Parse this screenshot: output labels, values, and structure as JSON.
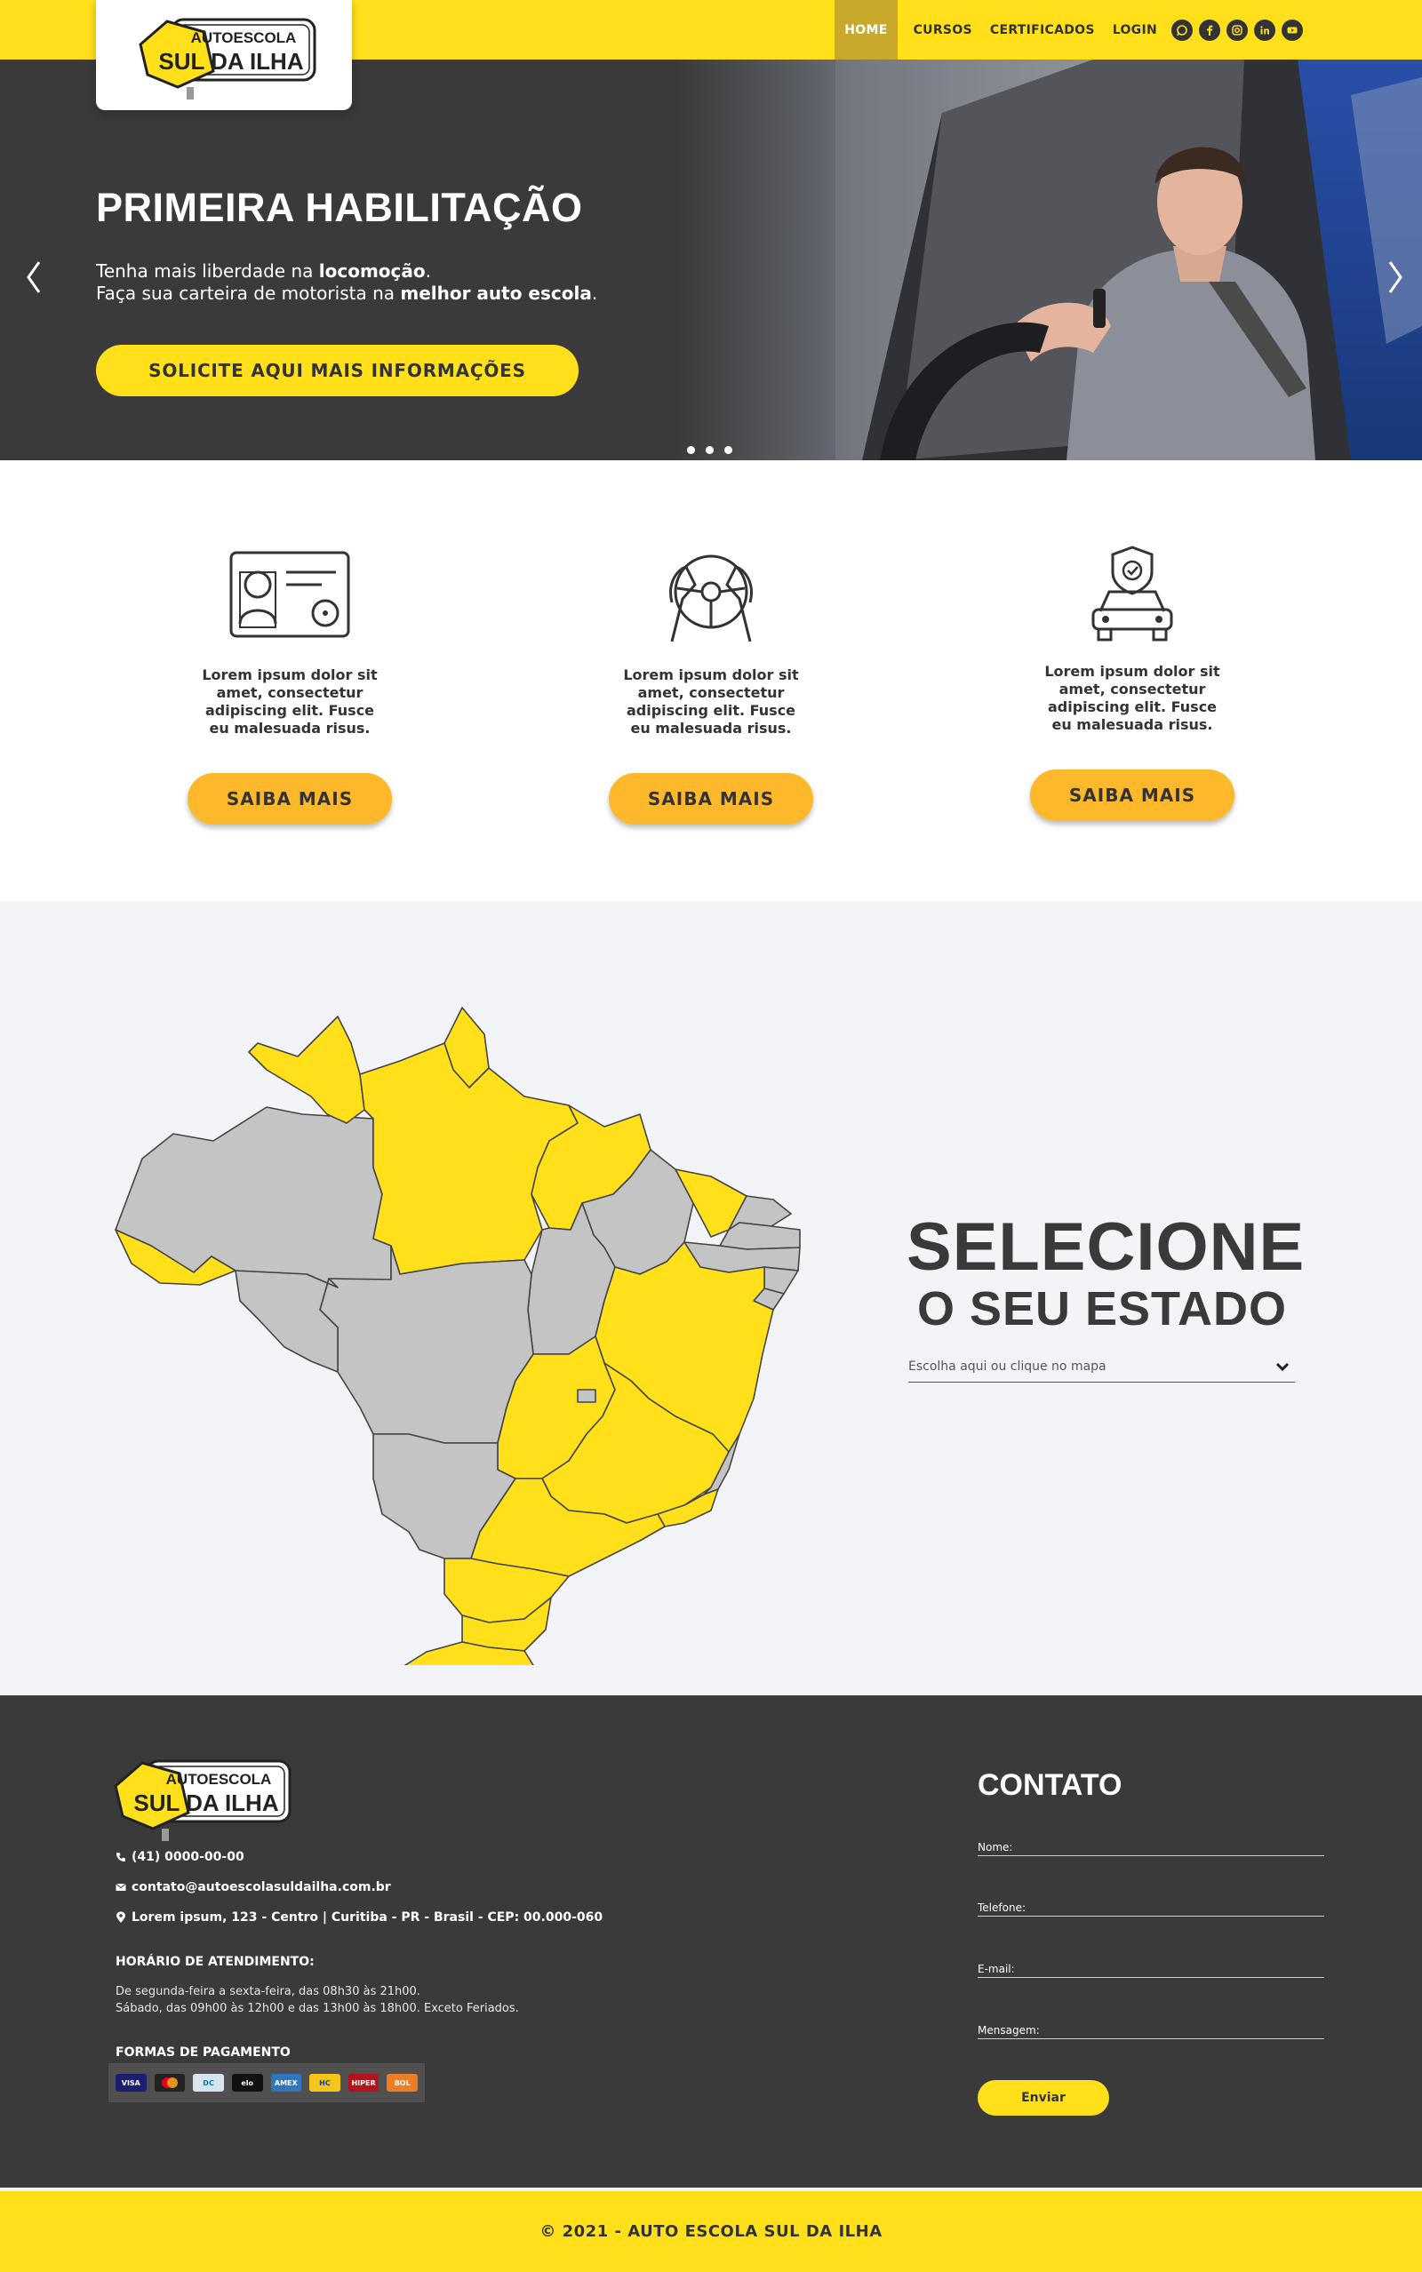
{
  "brand": {
    "logo_top": "AUTOESCOLA",
    "logo_main": "SUL DA ILHA"
  },
  "nav": {
    "items": [
      {
        "label": "HOME"
      },
      {
        "label": "CURSOS"
      },
      {
        "label": "CERTIFICADOS"
      },
      {
        "label": "LOGIN"
      }
    ],
    "socials": [
      "whatsapp-icon",
      "facebook-icon",
      "instagram-icon",
      "linkedin-icon",
      "youtube-icon"
    ]
  },
  "hero": {
    "title": "PRIMEIRA HABILITAÇÃO",
    "line1_pre": "Tenha mais liberdade na ",
    "line1_bold": "locomoção",
    "line1_post": ".",
    "line2_pre": "Faça sua carteira de motorista na ",
    "line2_bold": "melhor auto escola",
    "line2_post": ".",
    "cta": "SOLICITE AQUI MAIS INFORMAÇÕES",
    "slides_count": 3
  },
  "features": [
    {
      "icon": "driver-license-icon",
      "text": "Lorem ipsum dolor sit amet, consectetur adipiscing elit. Fusce eu malesuada risus.",
      "button": "SAIBA MAIS"
    },
    {
      "icon": "steering-wheel-icon",
      "text": "Lorem ipsum dolor sit amet, consectetur adipiscing elit. Fusce eu malesuada risus.",
      "button": "SAIBA MAIS"
    },
    {
      "icon": "car-shield-icon",
      "text": "Lorem ipsum dolor sit amet, consectetur adipiscing elit. Fusce eu malesuada risus.",
      "button": "SAIBA MAIS"
    }
  ],
  "map": {
    "title_line1": "SELECIONE",
    "title_line2": "O SEU ESTADO",
    "select_placeholder": "Escolha aqui ou clique no mapa",
    "highlight_color": "#ffe01b",
    "inactive_color": "#c4c4c4"
  },
  "footer": {
    "phone": "(41) 0000-00-00",
    "email": "contato@autoescolasuldailha.com.br",
    "address": "Lorem ipsum, 123 - Centro | Curitiba - PR - Brasil - CEP: 00.000-060",
    "hours_title": "HORÁRIO DE ATENDIMENTO:",
    "hours_line1": "De segunda-feira a sexta-feira, das 08h30 às 21h00.",
    "hours_line2": "Sábado, das 09h00 às 12h00 e das 13h00 às 18h00. Exceto Feriados.",
    "payment_title": "FORMAS DE PAGAMENTO",
    "payment_methods": [
      "VISA",
      "MC",
      "DC",
      "elo",
      "AMEX",
      "HC",
      "HIPER",
      "BOL"
    ],
    "contact_title": "CONTATO",
    "fields": {
      "name": "Nome:",
      "phone": "Telefone:",
      "email": "E-mail:",
      "message": "Mensagem:"
    },
    "send": "Enviar",
    "copyright": "© 2021 -  AUTO ESCOLA SUL DA ILHA"
  },
  "colors": {
    "brand_yellow": "#ffe01b",
    "dark": "#3a3a3a",
    "button_orange": "#fdb92b"
  }
}
